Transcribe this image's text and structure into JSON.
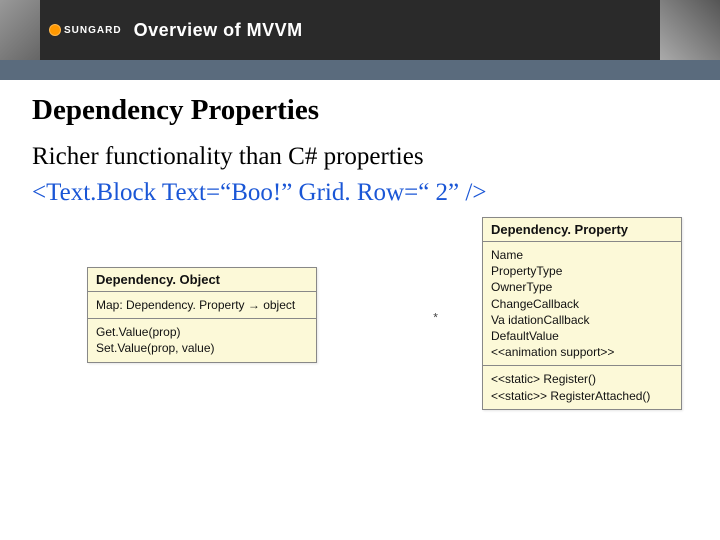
{
  "header": {
    "logo_text": "SUNGARD",
    "title": "Overview of MVVM"
  },
  "content": {
    "heading": "Dependency Properties",
    "subheading": "Richer functionality than C# properties",
    "code_line": "<Text.Block Text=“Boo!” Grid. Row=“ 2” />"
  },
  "diagram": {
    "object_box": {
      "title": "Dependency. Object",
      "section1_line1": "Map: Dependency. Property → object",
      "section2_line1": "Get.Value(prop)",
      "section2_line2": "Set.Value(prop, value)"
    },
    "property_box": {
      "title": "Dependency. Property",
      "attrs": {
        "l1": "Name",
        "l2": "PropertyType",
        "l3": "OwnerType",
        "l4": "ChangeCallback",
        "l5": "Va idationCallback",
        "l6": "DefaultValue",
        "l7": "<<animation support>>"
      },
      "ops": {
        "l1": "<<static> Register()",
        "l2": "<<static>> RegisterAttached()"
      }
    },
    "marker": "*"
  }
}
